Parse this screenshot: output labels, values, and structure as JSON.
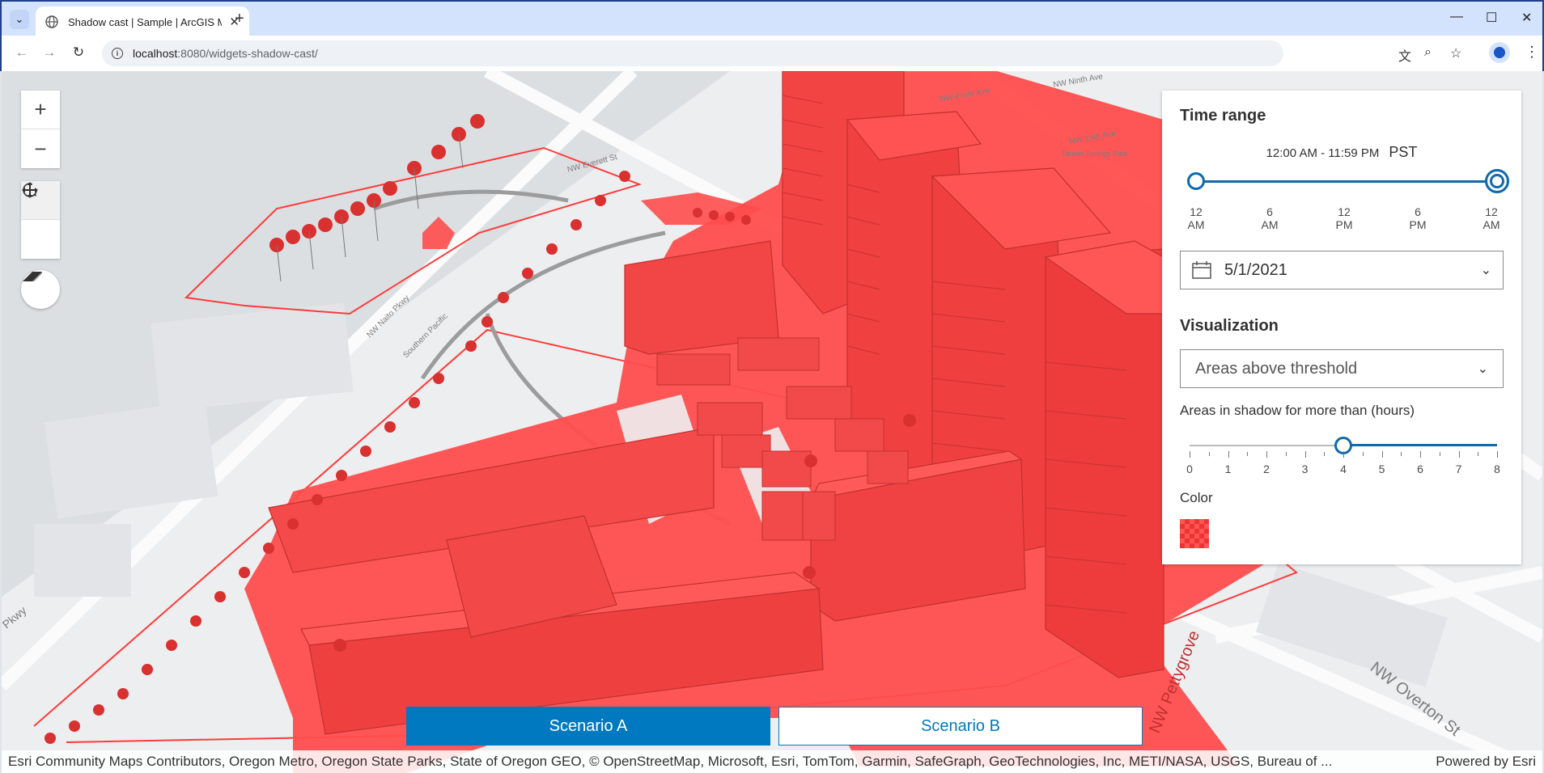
{
  "browser": {
    "tab_title": "Shadow cast | Sample | ArcGIS Maps SDK",
    "url_host": "localhost",
    "url_rest": ":8080/widgets-shadow-cast/"
  },
  "map": {
    "street_labels": [
      "NW Overton St",
      "Pkwy",
      "NW Naito Pkwy",
      "Southern Pacific",
      "NW 15th Ave",
      "NW Everett St",
      "NW Front Ave",
      "NW Ninth Ave",
      "Tanner Springs Park",
      "NW Pettygrove"
    ]
  },
  "panel": {
    "time_range_title": "Time range",
    "time_window": "12:00 AM - 11:59 PM",
    "timezone": "PST",
    "time_ticks": [
      {
        "top": "12",
        "bottom": "AM"
      },
      {
        "top": "6",
        "bottom": "AM"
      },
      {
        "top": "12",
        "bottom": "PM"
      },
      {
        "top": "6",
        "bottom": "PM"
      },
      {
        "top": "12",
        "bottom": "AM"
      }
    ],
    "date": "5/1/2021",
    "visualization_title": "Visualization",
    "visualization_value": "Areas above threshold",
    "threshold_label": "Areas in shadow for more than (hours)",
    "threshold_value": 4,
    "threshold_ticks": [
      "0",
      "1",
      "2",
      "3",
      "4",
      "5",
      "6",
      "7",
      "8"
    ],
    "color_label": "Color",
    "shadow_color": "#ff4d4d"
  },
  "scenarios": {
    "a_label": "Scenario A",
    "b_label": "Scenario B"
  },
  "attribution": {
    "sources": "Esri Community Maps Contributors, Oregon Metro, Oregon State Parks, State of Oregon GEO, © OpenStreetMap, Microsoft, Esri, TomTom, Garmin, SafeGraph, GeoTechnologies, Inc, METI/NASA, USGS, Bureau of ...",
    "powered_by": "Powered by Esri"
  },
  "colors": {
    "accent": "#0079c1",
    "slider": "#0f69ad",
    "shadow": "#ff4d4d"
  }
}
